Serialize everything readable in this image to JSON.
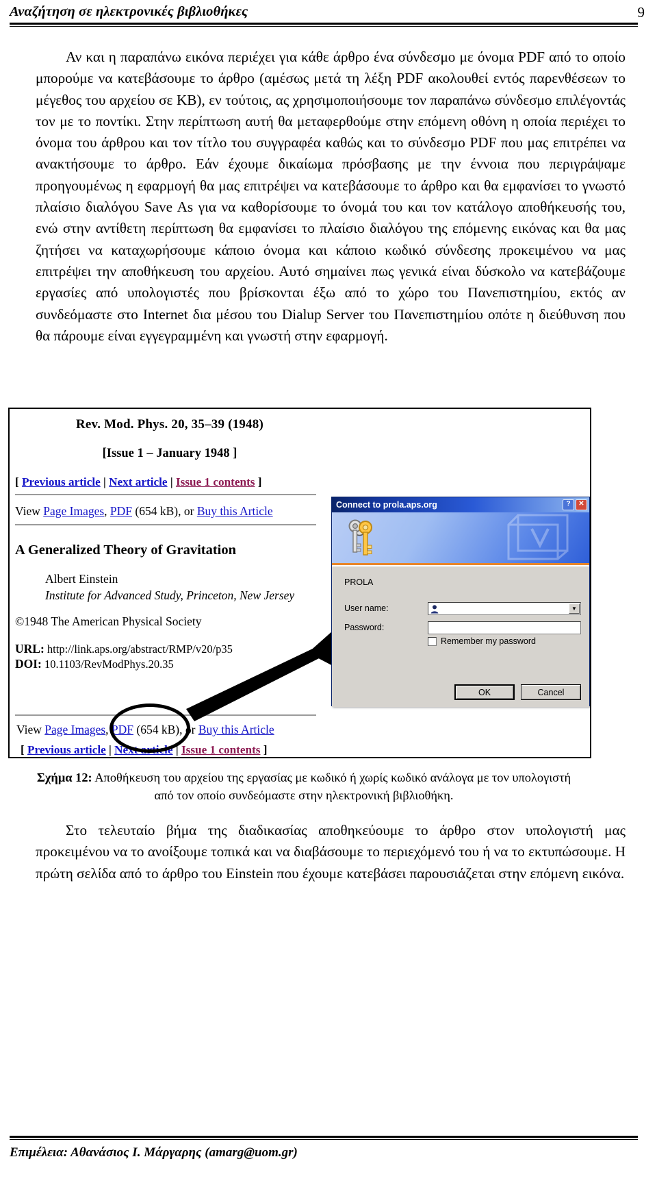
{
  "header": {
    "title": "Αναζήτηση σε ηλεκτρονικές βιβλιοθήκες",
    "page_number": "9"
  },
  "main": {
    "paragraph_1": "Αν και η παραπάνω εικόνα περιέχει για κάθε άρθρο ένα σύνδεσμο με όνομα PDF από το οποίο μπορούμε να κατεβάσουμε το άρθρο (αμέσως μετά τη λέξη PDF ακολουθεί εντός παρενθέσεων το μέγεθος του αρχείου σε ΚΒ), εν τούτοις, ας χρησιμοποιήσουμε τον παραπάνω σύνδεσμο επιλέγοντάς τον με το ποντίκι. Στην περίπτωση αυτή θα μεταφερθούμε στην επόμενη οθόνη η οποία περιέχει το όνομα του άρθρου και τον τίτλο του συγγραφέα καθώς και το σύνδεσμο PDF που μας επιτρέπει να ανακτήσουμε το άρθρο. Εάν έχουμε δικαίωμα πρόσβασης με την έννοια που περιγράψαμε προηγουμένως η εφαρμογή θα μας επιτρέψει να κατεβάσουμε το άρθρο και θα εμφανίσει το γνωστό πλαίσιο διαλόγου Save As για να καθορίσουμε το όνομά του και τον κατάλογο αποθήκευσής του, ενώ στην αντίθετη περίπτωση θα εμφανίσει το πλαίσιο διαλόγου της επόμενης εικόνας και θα μας ζητήσει να καταχωρήσουμε κάποιο όνομα και κάποιο κωδικό σύνδεσης προκειμένου να μας επιτρέψει την αποθήκευση του αρχείου. Αυτό σημαίνει πως γενικά είναι δύσκολο να κατεβάζουμε εργασίες από υπολογιστές που βρίσκονται έξω από το χώρο του Πανεπιστημίου, εκτός αν συνδεόμαστε στο Internet δια μέσου του Dialup Server του Πανεπιστημίου οπότε η διεύθυνση που θα πάρουμε είναι εγγεγραμμένη και γνωστή στην εφαρμογή.",
    "paragraph_2": "Στο τελευταίο βήμα της διαδικασίας αποθηκεύουμε το άρθρο στον υπολογιστή μας προκειμένου να το ανοίξουμε τοπικά και να διαβάσουμε το περιεχόμενό του ή να το εκτυπώσουμε. Η πρώτη σελίδα από το άρθρο του Einstein που έχουμε κατεβάσει παρουσιάζεται στην επόμενη εικόνα."
  },
  "figure": {
    "caption_label": "Σχήμα 12:",
    "caption_text": " Αποθήκευση του αρχείου της εργασίας με κωδικό ή χωρίς κωδικό ανάλογα με τον υπολογιστή από τον οποίο συνδεόμαστε στην ηλεκτρονική βιβλιοθήκη.",
    "aps_page": {
      "citation": "Rev. Mod. Phys. 20, 35–39 (1948)",
      "issue": "[Issue 1 – January 1948 ]",
      "nav": {
        "open_bracket": "[",
        "previous_article": "Previous article",
        "separator": "|",
        "next_article": "Next article",
        "issue_contents": "Issue 1 contents",
        "close_bracket": "]"
      },
      "view_line": {
        "view_word": "View",
        "page_images": "Page Images",
        "comma": ",",
        "pdf": "PDF",
        "size": "(654 kB),",
        "or_word": "or",
        "buy": "Buy this Article"
      },
      "article_title": "A Generalized Theory of Gravitation",
      "author": "Albert Einstein",
      "affiliation": "Institute for Advanced Study, Princeton, New Jersey",
      "copyright": "©1948 The American Physical Society",
      "url_label": "URL:",
      "url_value": "http://link.aps.org/abstract/RMP/v20/p35",
      "doi_label": "DOI:",
      "doi_value": "10.1103/RevModPhys.20.35"
    },
    "dialog": {
      "title": "Connect to prola.aps.org",
      "help_button": "?",
      "close_button": "✕",
      "realm": "PROLA",
      "username_label": "User name:",
      "username_value": "",
      "password_label": "Password:",
      "password_value": "",
      "remember_label": "Remember my password",
      "remember_checked": false,
      "ok_button": "OK",
      "cancel_button": "Cancel"
    }
  },
  "footer": {
    "text": "Επιμέλεια: Αθανάσιος Ι. Μάργαρης (amarg@uom.gr)"
  },
  "colors": {
    "link": "#1414c8",
    "visited_link": "#8c1a52",
    "titlebar_start": "#0a246a",
    "titlebar_end": "#8fb6ef",
    "dialog_face": "#d6d3ce",
    "banner_accent": "#e8862a"
  }
}
